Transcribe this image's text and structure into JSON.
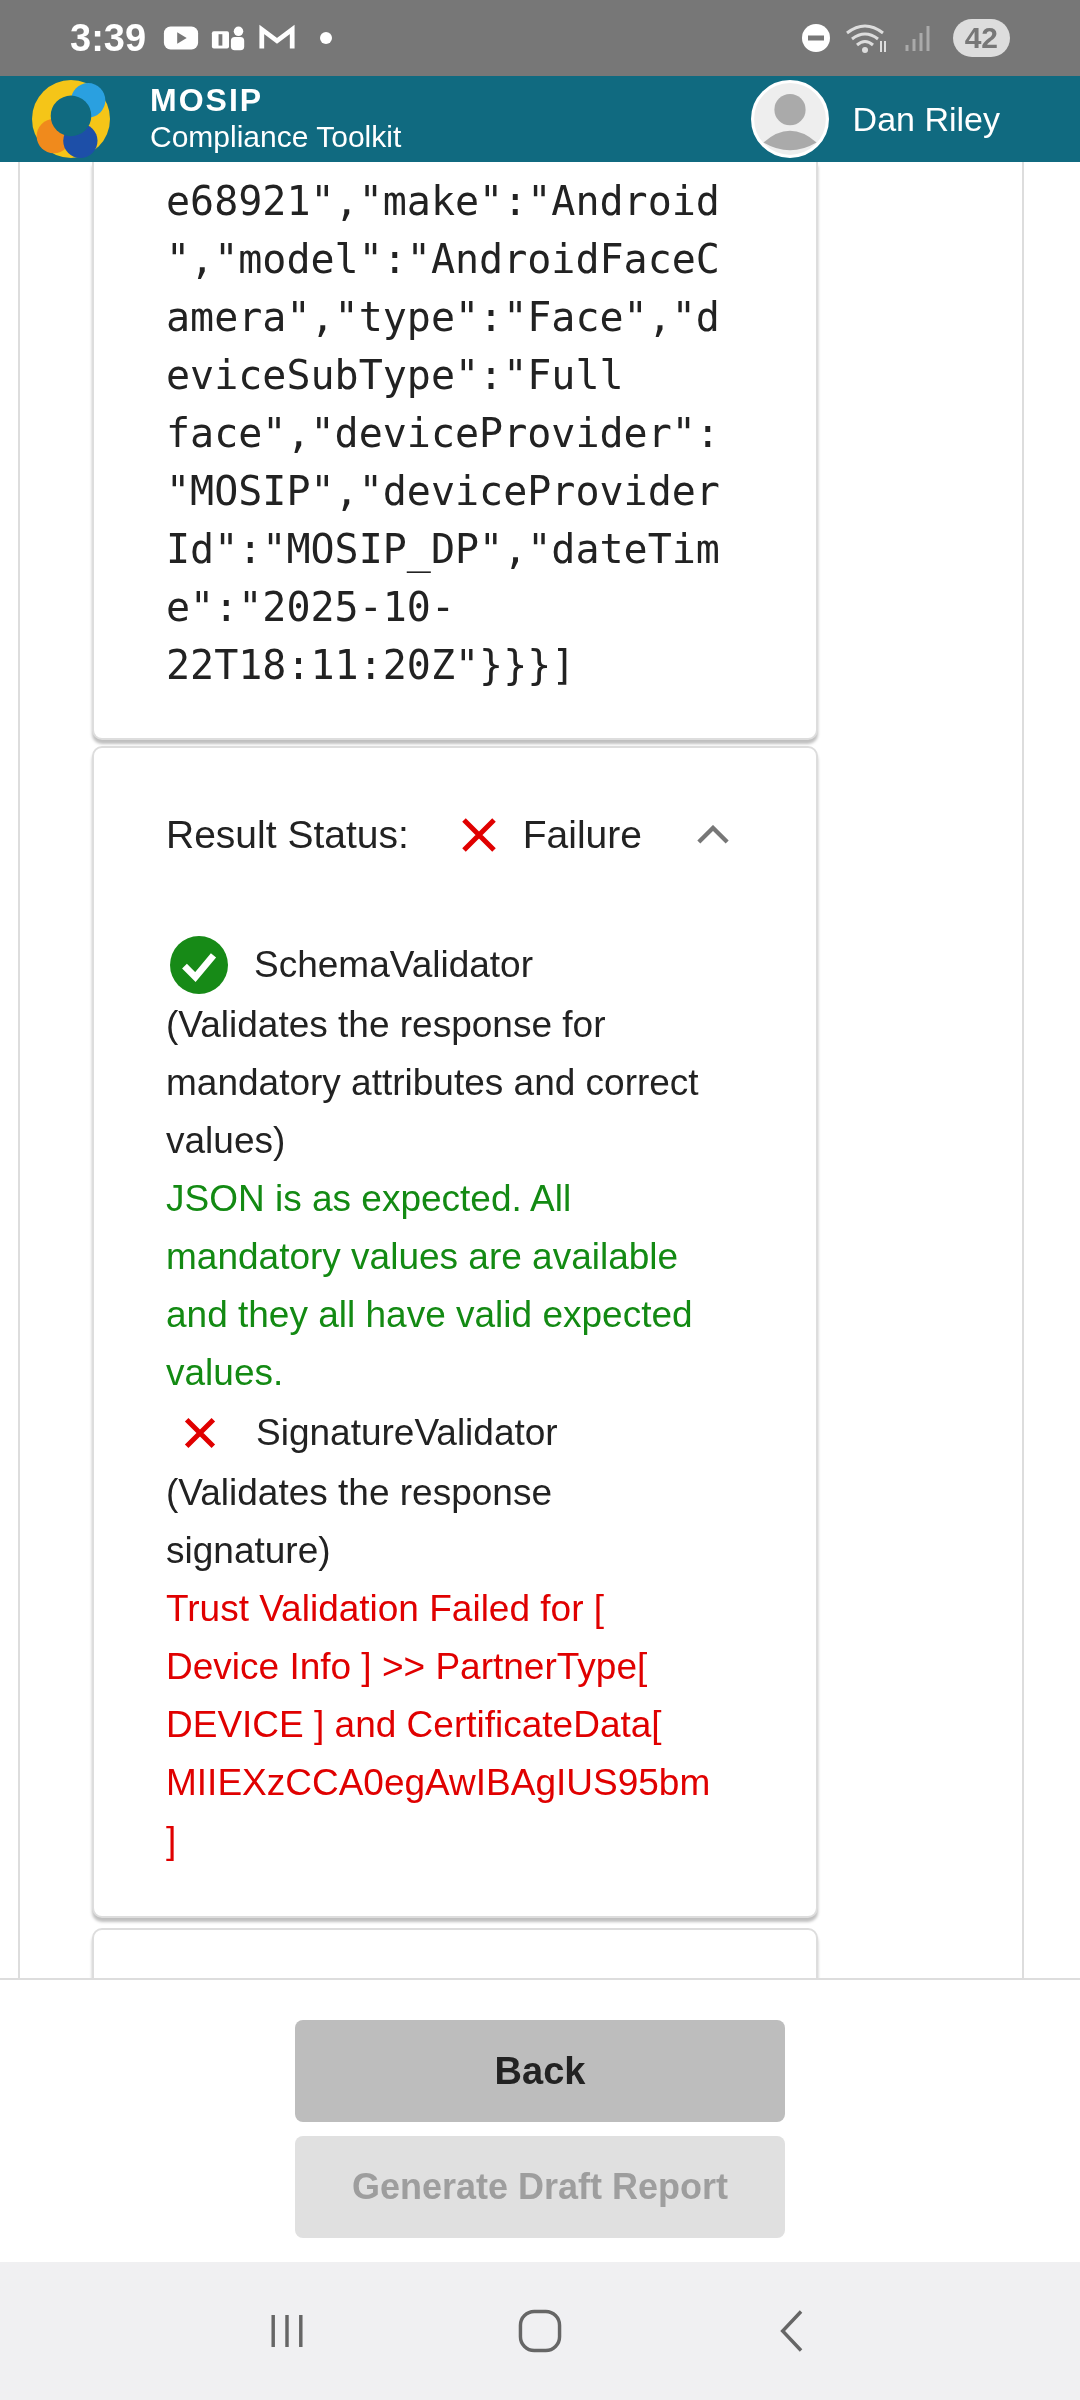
{
  "status_bar": {
    "time": "3:39",
    "battery": "42"
  },
  "header": {
    "title": "MOSIP",
    "subtitle": "Compliance Toolkit",
    "user_name": "Dan Riley"
  },
  "request_text": "e68921\",\"make\":\"Android\",\"model\":\"AndroidFaceCamera\",\"type\":\"Face\",\"deviceSubType\":\"Full face\",\"deviceProvider\":\"MOSIP\",\"deviceProviderId\":\"MOSIP_DP\",\"dateTime\":\"2025-10-22T18:11:20Z\"}}}]",
  "result": {
    "label": "Result Status:",
    "passed": false,
    "status": "Failure",
    "expanded": true
  },
  "validators": [
    {
      "name": "SchemaValidator",
      "passed": true,
      "description": "(Validates the response for mandatory attributes and correct values)",
      "message": "JSON is as expected. All mandatory values are available and they all have valid expected values."
    },
    {
      "name": "SignatureValidator",
      "passed": false,
      "description": "(Validates the response signature)",
      "message": "Trust Validation Failed for [ Device Info ] >> PartnerType[ DEVICE ] and CertificateData[ MIIEXzCCA0egAwIBAgIUS95bm ]"
    }
  ],
  "buttons": [
    {
      "label": "Back",
      "disabled": false
    },
    {
      "label": "Generate Draft Report",
      "disabled": true
    }
  ]
}
